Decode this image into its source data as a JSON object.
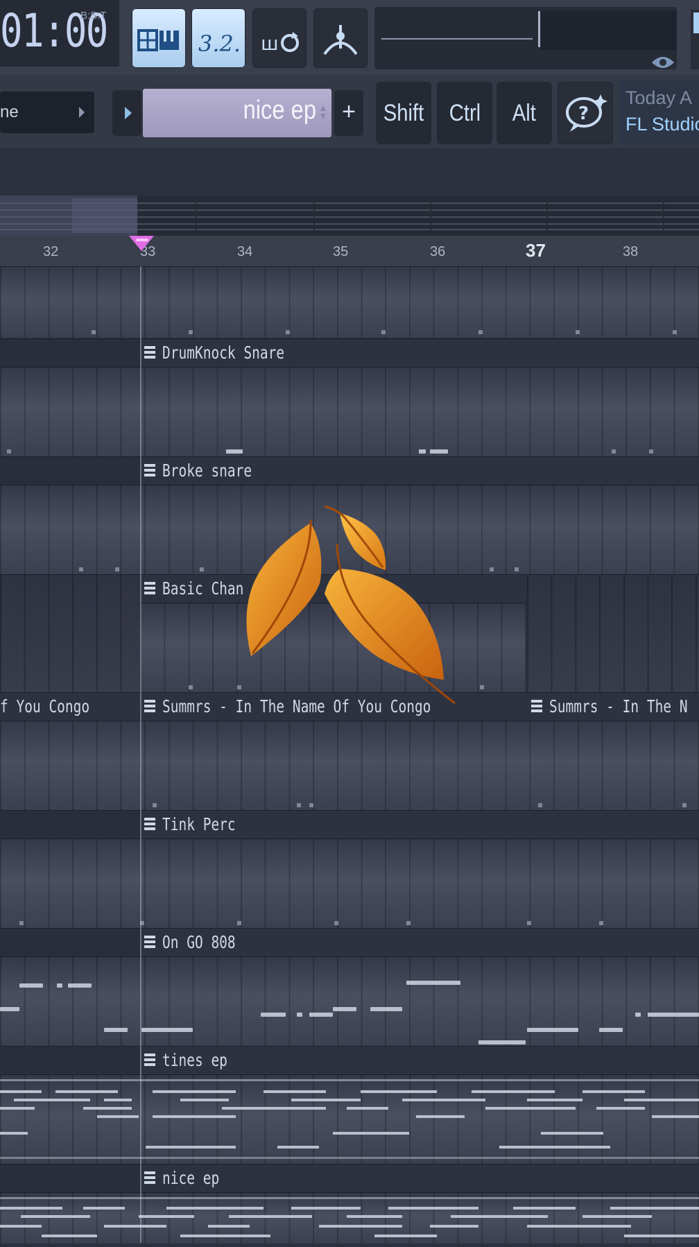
{
  "toolbar": {
    "time": "01:00",
    "time_format": "B:S:T",
    "pattern_left_label": "ne",
    "pattern_name": "nice ep",
    "add_pattern_label": "+",
    "modifier_keys": [
      "Shift",
      "Ctrl",
      "Alt"
    ],
    "hint_line1": "Today A",
    "hint_line2": "FL Studio",
    "active_color": "#bcdcf8"
  },
  "ruler": {
    "bars": [
      {
        "label": "32",
        "major": false
      },
      {
        "label": "33",
        "major": false
      },
      {
        "label": "34",
        "major": false
      },
      {
        "label": "35",
        "major": false
      },
      {
        "label": "36",
        "major": false
      },
      {
        "label": "37",
        "major": true
      },
      {
        "label": "38",
        "major": false
      }
    ],
    "playhead_color": "#e06ee4"
  },
  "tracks": [
    {
      "clips": []
    },
    {
      "clips": [
        {
          "label": "DrumKnock Snare"
        }
      ]
    },
    {
      "clips": [
        {
          "label": "Broke snare"
        }
      ]
    },
    {
      "clips": [
        {
          "label": "Basic Chan"
        }
      ]
    },
    {
      "clips": [
        {
          "label": "f You Congo"
        },
        {
          "label": "Summrs - In The Name Of You Congo"
        },
        {
          "label": "Summrs - In The N"
        }
      ]
    },
    {
      "clips": [
        {
          "label": "Tink Perc"
        }
      ]
    },
    {
      "clips": [
        {
          "label": "On GO 808"
        }
      ]
    },
    {
      "clips": [
        {
          "label": "tines ep"
        }
      ]
    },
    {
      "clips": [
        {
          "label": "nice ep"
        }
      ]
    }
  ],
  "overlay": {
    "icon": "autumn-leaves-icon"
  }
}
